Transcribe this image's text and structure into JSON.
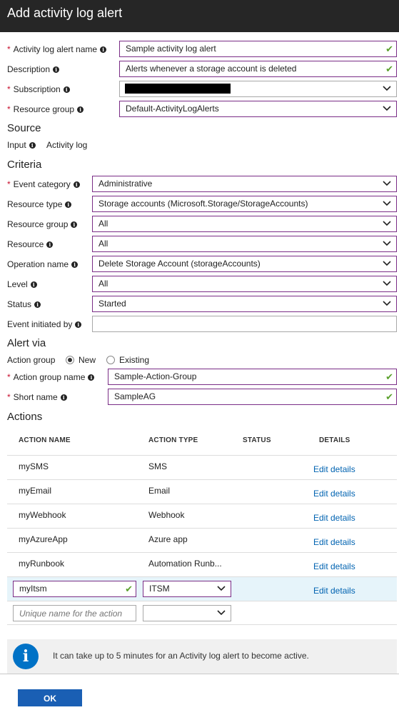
{
  "window": {
    "title": "Add activity log alert"
  },
  "form": {
    "alert_name": {
      "label": "Activity log alert name",
      "value": "Sample activity log alert"
    },
    "description": {
      "label": "Description",
      "value": "Alerts whenever a storage account is deleted"
    },
    "subscription": {
      "label": "Subscription",
      "value": ""
    },
    "resource_group": {
      "label": "Resource group",
      "value": "Default-ActivityLogAlerts"
    }
  },
  "source": {
    "heading": "Source",
    "input_label": "Input",
    "input_value": "Activity log"
  },
  "criteria": {
    "heading": "Criteria",
    "event_category": {
      "label": "Event category",
      "value": "Administrative"
    },
    "resource_type": {
      "label": "Resource type",
      "value": "Storage accounts (Microsoft.Storage/StorageAccounts)"
    },
    "resource_group": {
      "label": "Resource group",
      "value": "All"
    },
    "resource": {
      "label": "Resource",
      "value": "All"
    },
    "operation_name": {
      "label": "Operation name",
      "value": "Delete Storage Account (storageAccounts)"
    },
    "level": {
      "label": "Level",
      "value": "All"
    },
    "status": {
      "label": "Status",
      "value": "Started"
    },
    "event_initiated_by": {
      "label": "Event initiated by",
      "value": ""
    }
  },
  "alert_via": {
    "heading": "Alert via",
    "action_group_label": "Action group",
    "option_new": "New",
    "option_existing": "Existing",
    "selected": "New",
    "action_group_name": {
      "label": "Action group name",
      "value": "Sample-Action-Group"
    },
    "short_name": {
      "label": "Short name",
      "value": "SampleAG"
    }
  },
  "actions": {
    "heading": "Actions",
    "columns": [
      "ACTION NAME",
      "ACTION TYPE",
      "STATUS",
      "DETAILS"
    ],
    "rows": [
      {
        "name": "mySMS",
        "type": "SMS",
        "status": "",
        "details": "Edit details"
      },
      {
        "name": "myEmail",
        "type": "Email",
        "status": "",
        "details": "Edit details"
      },
      {
        "name": "myWebhook",
        "type": "Webhook",
        "status": "",
        "details": "Edit details"
      },
      {
        "name": "myAzureApp",
        "type": "Azure app",
        "status": "",
        "details": "Edit details"
      },
      {
        "name": "myRunbook",
        "type": "Automation Runb...",
        "status": "",
        "details": "Edit details"
      },
      {
        "name": "myItsm",
        "type": "ITSM",
        "status": "",
        "details": "Edit details"
      }
    ],
    "new_row": {
      "name_placeholder": "Unique name for the action",
      "type_value": ""
    }
  },
  "notice": {
    "icon": "info-icon",
    "text": "It can take up to 5 minutes for an Activity log alert to become active."
  },
  "footer": {
    "ok_label": "OK"
  },
  "colors": {
    "accent_border": "#7a2d86",
    "link": "#0063b1",
    "button": "#1a5fb4",
    "check": "#5aa02c",
    "required": "#c8102e"
  }
}
